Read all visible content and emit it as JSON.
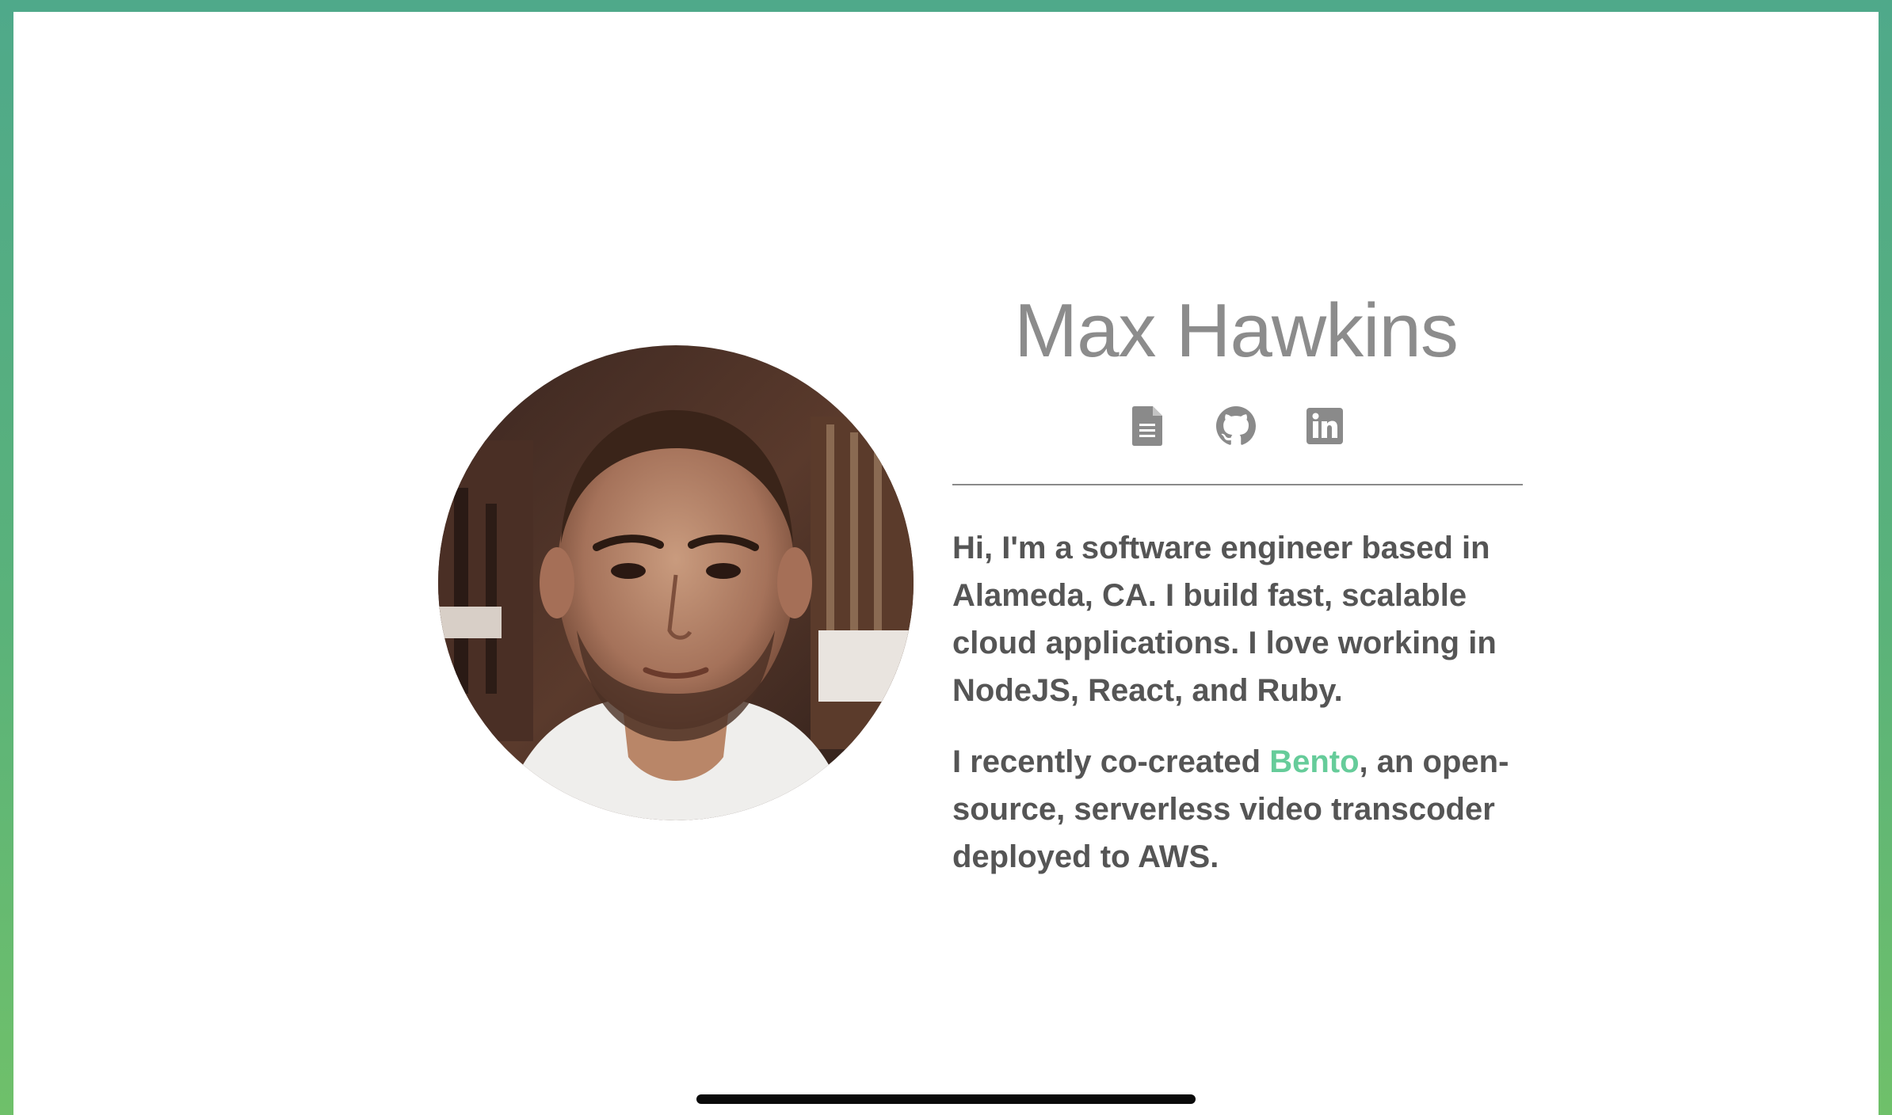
{
  "profile": {
    "name": "Max Hawkins",
    "photo_alt": "Max Hawkins portrait"
  },
  "links": [
    {
      "icon": "document-icon",
      "label": "Resume"
    },
    {
      "icon": "github-icon",
      "label": "GitHub"
    },
    {
      "icon": "linkedin-icon",
      "label": "LinkedIn"
    }
  ],
  "bio": {
    "paragraph1": "Hi, I'm a software engineer based in Alameda, CA. I build fast, scalable cloud applications. I love working in NodeJS, React, and Ruby.",
    "paragraph2_before": "I recently co-created ",
    "paragraph2_link": "Bento",
    "paragraph2_after": ", an open-source, serverless video transcoder deployed to AWS."
  },
  "colors": {
    "frame_gradient_top": "#4fa98a",
    "frame_gradient_bottom": "#6fc06a",
    "name_text": "#8c8c8c",
    "body_text": "#555555",
    "link": "#66cc9a",
    "icon": "#8a8a8a"
  }
}
